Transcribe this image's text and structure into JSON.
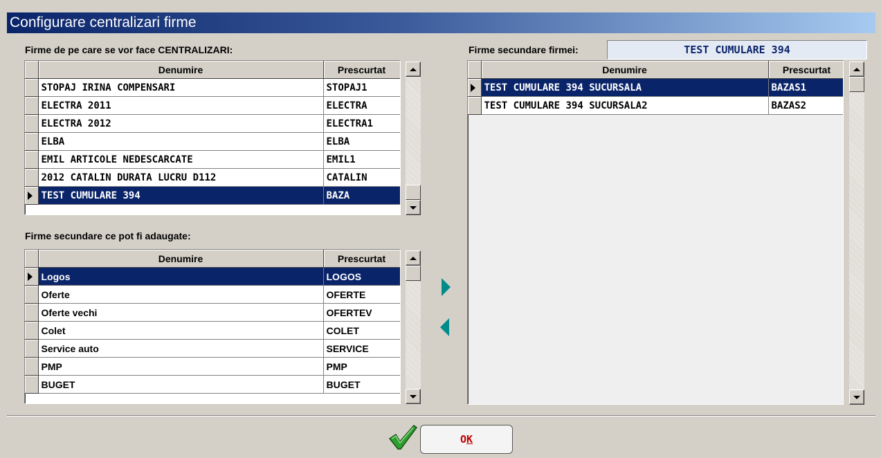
{
  "window": {
    "title": "Configurare centralizari firme"
  },
  "left_top": {
    "label": "Firme de pe care se vor face CENTRALIZARI:",
    "headers": {
      "name": "Denumire",
      "abbr": "Prescurtat"
    },
    "rows": [
      {
        "name": "STOPAJ IRINA COMPENSARI",
        "abbr": "STOPAJ1"
      },
      {
        "name": "ELECTRA 2011",
        "abbr": "ELECTRA"
      },
      {
        "name": "ELECTRA 2012",
        "abbr": "ELECTRA1"
      },
      {
        "name": "ELBA",
        "abbr": "ELBA"
      },
      {
        "name": "EMIL ARTICOLE NEDESCARCATE",
        "abbr": "EMIL1"
      },
      {
        "name": "2012 CATALIN DURATA LUCRU D112",
        "abbr": "CATALIN"
      },
      {
        "name": "TEST CUMULARE 394",
        "abbr": "BAZA"
      }
    ],
    "selected_index": 6
  },
  "left_bottom": {
    "label": "Firme secundare ce pot fi adaugate:",
    "headers": {
      "name": "Denumire",
      "abbr": "Prescurtat"
    },
    "rows": [
      {
        "name": "Logos",
        "abbr": "LOGOS"
      },
      {
        "name": "Oferte",
        "abbr": "OFERTE"
      },
      {
        "name": "Oferte vechi",
        "abbr": "OFERTEV"
      },
      {
        "name": "Colet",
        "abbr": "COLET"
      },
      {
        "name": "Service auto",
        "abbr": "SERVICE"
      },
      {
        "name": "PMP",
        "abbr": "PMP"
      },
      {
        "name": "BUGET",
        "abbr": "BUGET"
      }
    ],
    "selected_index": 0
  },
  "right": {
    "label": "Firme secundare firmei:",
    "firm_value": "TEST CUMULARE 394",
    "headers": {
      "name": "Denumire",
      "abbr": "Prescurtat"
    },
    "rows": [
      {
        "name": "TEST CUMULARE 394 SUCURSALA",
        "abbr": "BAZAS1"
      },
      {
        "name": "TEST CUMULARE 394 SUCURSALA2",
        "abbr": "BAZAS2"
      }
    ],
    "selected_index": 0
  },
  "transfer": {
    "add_icon": "triangle-right-icon",
    "remove_icon": "triangle-left-icon"
  },
  "footer": {
    "ok_prefix": "O",
    "ok_underlined": "K",
    "check_icon": "green-checkmark-icon"
  },
  "colors": {
    "title_bar": "#0a246a",
    "selection": "#0a246a",
    "arrow": "#008b8b",
    "ok_text": "#c00000",
    "check": "#2e9e2e"
  }
}
